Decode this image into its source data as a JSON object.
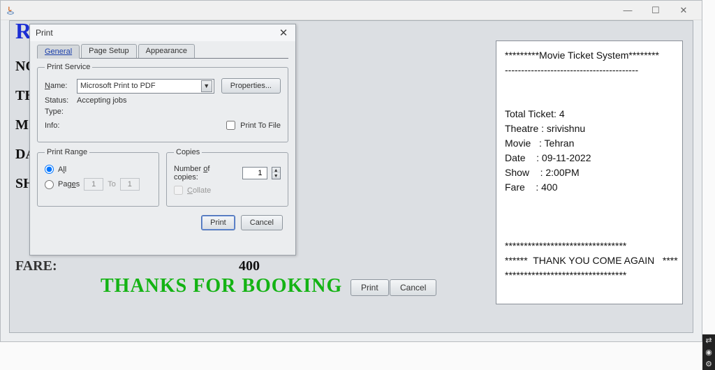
{
  "window": {
    "title": ""
  },
  "receipt": {
    "heading": "RECEIPT",
    "labels": {
      "no": "NO",
      "th": "TH",
      "m": "M",
      "da": "DA",
      "sh": "SH",
      "fare": "FARE:"
    },
    "fare_value": "400",
    "thanks": "THANKS FOR BOOKING",
    "print_btn": "Print",
    "cancel_btn": "Cancel"
  },
  "summary": {
    "header_line": "*********Movie Ticket System********",
    "divider": "-----------------------------------------",
    "total_ticket_label": "Total Ticket:",
    "total_ticket": "4",
    "theatre_label": "Theatre :",
    "theatre": "srivishnu",
    "movie_label": "Movie   :",
    "movie": "Tehran",
    "date_label": "Date    :",
    "date": "09-11-2022",
    "show_label": "Show    :",
    "show": "2:00PM",
    "fare_label": "Fare    :",
    "fare": "400",
    "stars_line": "********************************",
    "thank_line": "******  THANK YOU COME AGAIN   ****",
    "stars_line2": "********************************"
  },
  "print_dialog": {
    "title": "Print",
    "tabs": {
      "general": "General",
      "page_setup": "Page Setup",
      "appearance": "Appearance"
    },
    "print_service": {
      "legend": "Print Service",
      "name_label": "Name:",
      "selected_printer": "Microsoft Print to PDF",
      "properties_btn": "Properties...",
      "status_label": "Status:",
      "status_value": "Accepting jobs",
      "type_label": "Type:",
      "info_label": "Info:",
      "print_to_file": "Print To File"
    },
    "print_range": {
      "legend": "Print Range",
      "all": "All",
      "pages": "Pages",
      "from": "1",
      "to_label": "To",
      "to": "1"
    },
    "copies": {
      "legend": "Copies",
      "number_label": "Number of copies:",
      "number_value": "1",
      "collate": "Collate"
    },
    "actions": {
      "print": "Print",
      "cancel": "Cancel"
    }
  }
}
